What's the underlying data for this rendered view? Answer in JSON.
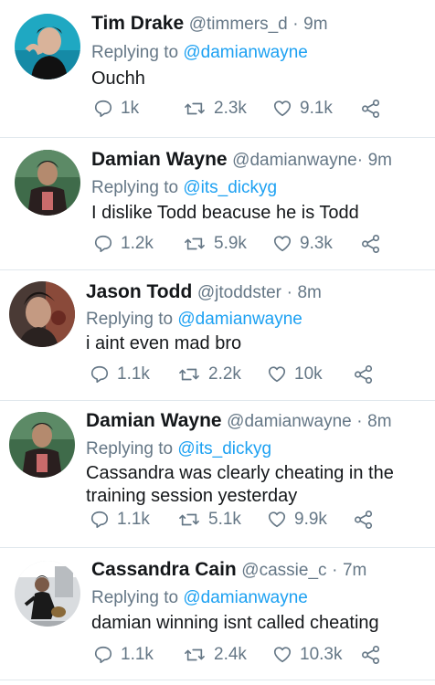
{
  "tweets": [
    {
      "name": "Tim Drake",
      "handle": "@timmers_d",
      "dot": "·",
      "time": "9m",
      "replying_prefix": "Replying to",
      "replying_to": "@damianwayne",
      "text": "Ouchh",
      "replies": "1k",
      "retweets": "2.3k",
      "likes": "9.1k",
      "avatar_bg": "#1fa8c2"
    },
    {
      "name": "Damian Wayne",
      "handle": "@damianwayne",
      "dot": "·",
      "time": "9m",
      "replying_prefix": "Replying to",
      "replying_to": "@its_dickyg",
      "text": "I dislike Todd beacuse he is Todd",
      "replies": "1.2k",
      "retweets": "5.9k",
      "likes": "9.3k",
      "avatar_bg": "#3f6b4a"
    },
    {
      "name": "Jason Todd",
      "handle": "@jtoddster",
      "dot": "·",
      "time": "8m",
      "replying_prefix": "Replying to",
      "replying_to": "@damianwayne",
      "text": "i aint even mad bro",
      "replies": "1.1k",
      "retweets": "2.2k",
      "likes": "10k",
      "avatar_bg": "#7a5a4a"
    },
    {
      "name": "Damian Wayne",
      "handle": "@damianwayne",
      "dot": "·",
      "time": "8m",
      "replying_prefix": "Replying to",
      "replying_to": "@its_dickyg",
      "text": "Cassandra was clearly cheating in the training session yesterday",
      "replies": "1.1k",
      "retweets": "5.1k",
      "likes": "9.9k",
      "avatar_bg": "#3f6b4a"
    },
    {
      "name": "Cassandra Cain",
      "handle": "@cassie_c",
      "dot": "·",
      "time": "7m",
      "replying_prefix": "Replying to",
      "replying_to": "@damianwayne",
      "text": "damian winning isnt called cheating",
      "replies": "1.1k",
      "retweets": "2.4k",
      "likes": "10.3k",
      "avatar_bg": "#d9dcdf"
    }
  ],
  "colors": {
    "link": "#1da1f2",
    "muted": "#657786",
    "divider": "#e1e8ed"
  },
  "icons": [
    "reply-icon",
    "retweet-icon",
    "like-icon",
    "share-icon"
  ]
}
